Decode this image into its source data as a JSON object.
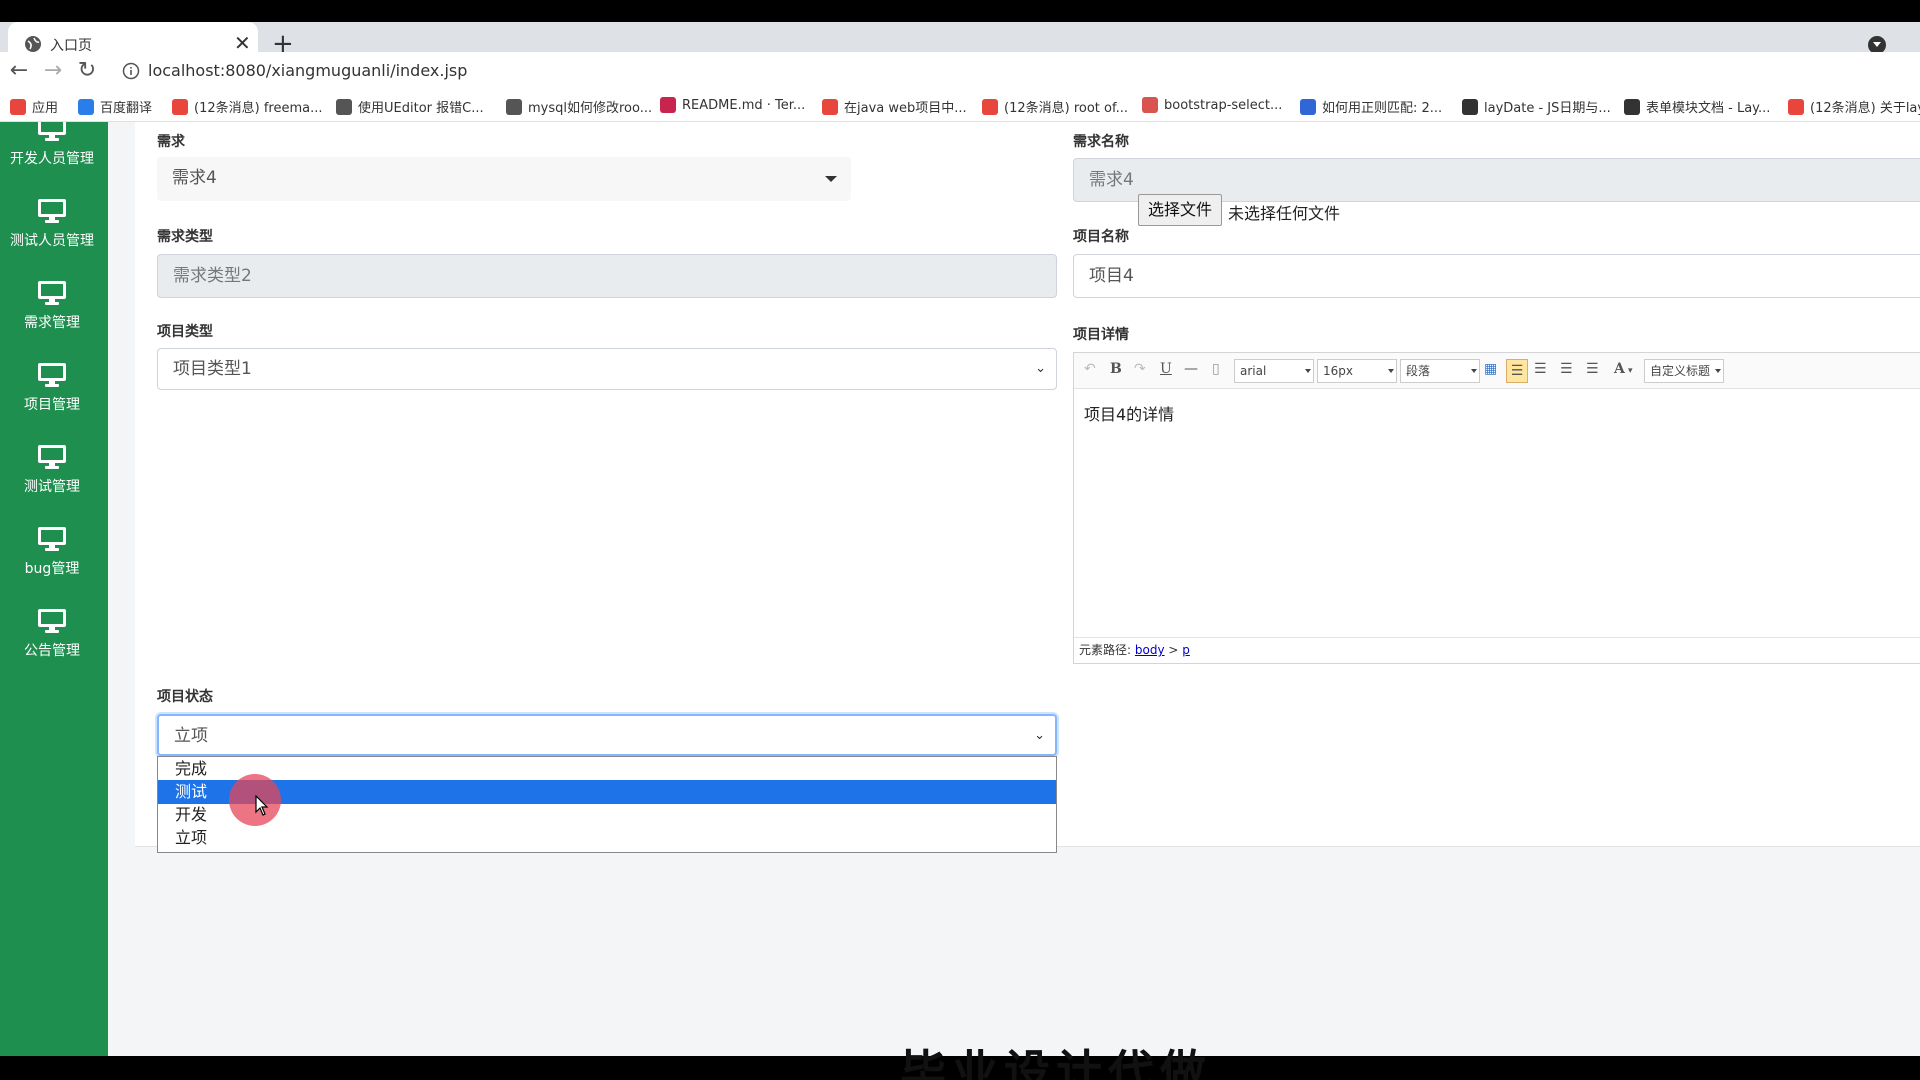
{
  "browser": {
    "tab_title": "入口页",
    "url": "localhost:8080/xiangmuguanli/index.jsp",
    "bookmarks": [
      {
        "label": "应用",
        "color": "#e8453c"
      },
      {
        "label": "百度翻译",
        "color": "#2b7de9"
      },
      {
        "label": "(12条消息) freema...",
        "color": "#e8453c"
      },
      {
        "label": "使用UEditor 报错C...",
        "color": "#555555"
      },
      {
        "label": "mysql如何修改roo...",
        "color": "#555555"
      },
      {
        "label": "README.md · Ter...",
        "color": "#c7254e"
      },
      {
        "label": "在java web项目中...",
        "color": "#e8453c"
      },
      {
        "label": "(12条消息) root of...",
        "color": "#e8453c"
      },
      {
        "label": "bootstrap-select...",
        "color": "#d9534f"
      },
      {
        "label": "如何用正则匹配: 2...",
        "color": "#3066d6"
      },
      {
        "label": "layDate - JS日期与...",
        "color": "#333333"
      },
      {
        "label": "表单模块文档 - Lay...",
        "color": "#333333"
      },
      {
        "label": "(12条消息) 关于lay",
        "color": "#e8453c"
      }
    ]
  },
  "sidebar": {
    "items": [
      {
        "label": "开发人员管理"
      },
      {
        "label": "测试人员管理"
      },
      {
        "label": "需求管理"
      },
      {
        "label": "项目管理"
      },
      {
        "label": "测试管理"
      },
      {
        "label": "bug管理"
      },
      {
        "label": "公告管理"
      }
    ]
  },
  "form": {
    "requirement_label": "需求",
    "requirement_value": "需求4",
    "requirement_name_label": "需求名称",
    "requirement_name_value": "需求4",
    "requirement_type_label": "需求类型",
    "requirement_type_value": "需求类型2",
    "project_name_label": "项目名称",
    "project_name_value": "项目4",
    "project_type_label": "项目类型",
    "project_type_value": "项目类型1",
    "project_detail_label": "项目详情",
    "file_button": "选择文件",
    "file_none": "未选择任何文件",
    "project_status_label": "项目状态",
    "project_status_value": "立项",
    "status_options": [
      "完成",
      "测试",
      "开发",
      "立项"
    ],
    "status_highlighted": "测试"
  },
  "editor": {
    "font_family": "arial",
    "font_size": "16px",
    "paragraph": "段落",
    "custom_title": "自定义标题",
    "body_text": "项目4的详情",
    "path_label": "元素路径:",
    "path_body": "body",
    "path_sep": ">",
    "path_p": "p"
  },
  "watermark_text": "毕业设计代做",
  "colors": {
    "sidebar": "#1e8f4e",
    "selected_option": "#1e73e8"
  }
}
